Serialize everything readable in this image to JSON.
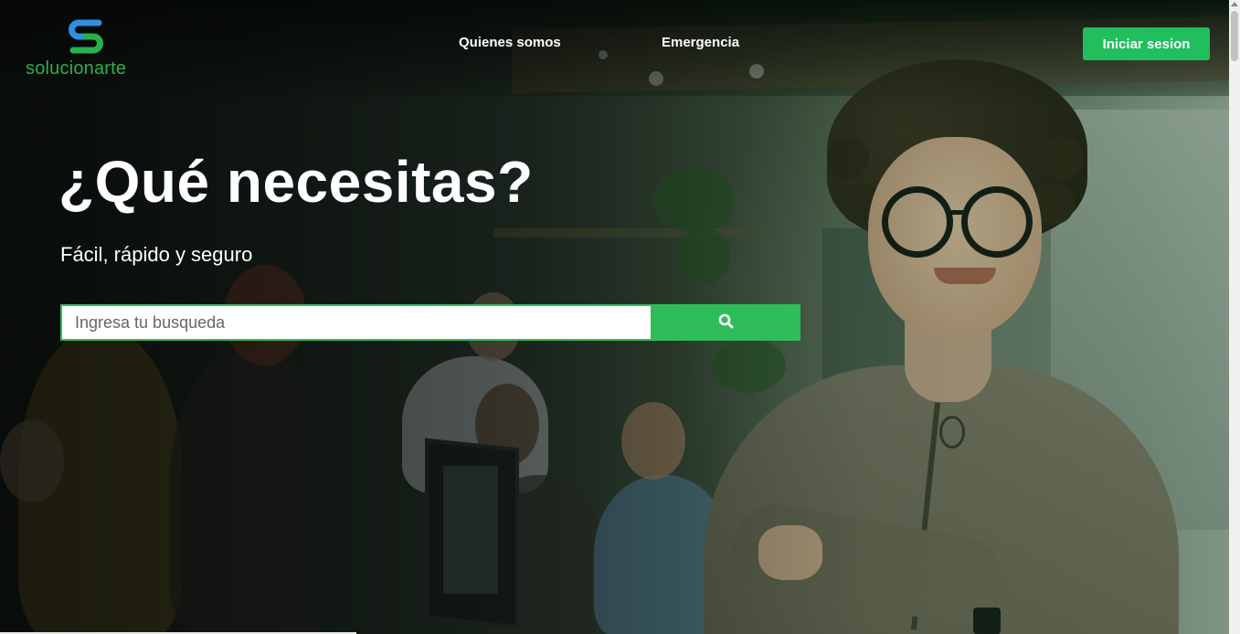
{
  "brand": {
    "name": "solucionarte",
    "logo_icon": "s-monogram-icon",
    "colors": {
      "primary_green": "#21be5e",
      "logo_blue": "#2f8fe0",
      "logo_green": "#2ab04a"
    }
  },
  "nav": {
    "links": [
      {
        "label": "Quienes somos"
      },
      {
        "label": "Emergencia"
      }
    ],
    "login_label": "Iniciar sesion"
  },
  "hero": {
    "title": "¿Qué necesitas?",
    "subtitle": "Fácil, rápido y seguro",
    "search": {
      "placeholder": "Ingresa tu busqueda",
      "value": "",
      "button_icon": "search-icon"
    }
  }
}
